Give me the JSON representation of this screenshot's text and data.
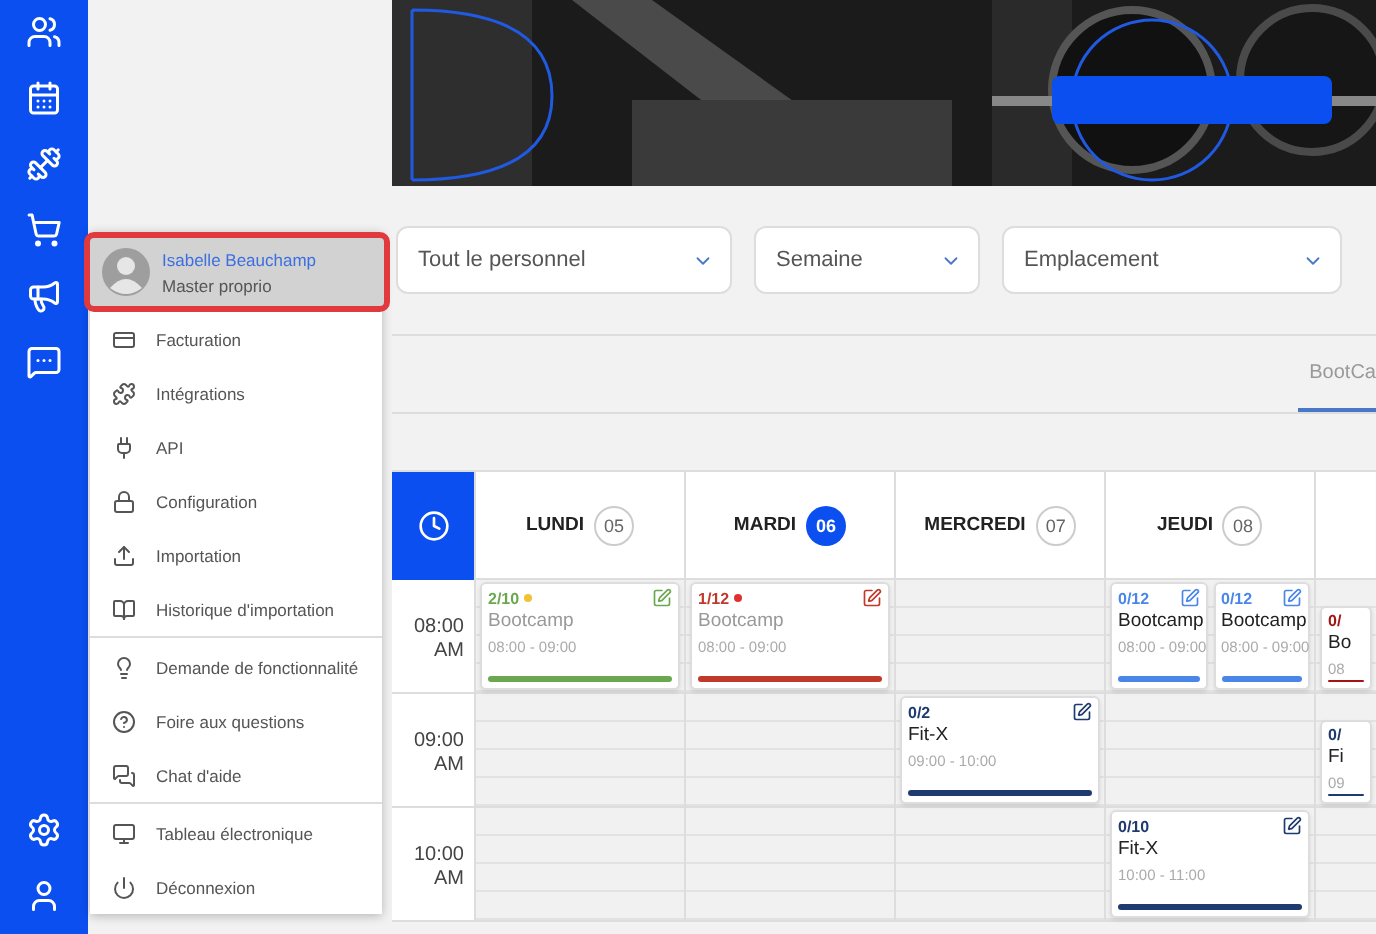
{
  "filters": [
    {
      "label": "Tout le personnel"
    },
    {
      "label": "Semaine"
    },
    {
      "label": "Emplacement"
    }
  ],
  "tabs": [
    {
      "label": "BootCa",
      "selected": true
    }
  ],
  "calendar": {
    "days": [
      {
        "name": "LUNDI",
        "date": "05",
        "selected": false
      },
      {
        "name": "MARDI",
        "date": "06",
        "selected": true
      },
      {
        "name": "MERCREDI",
        "date": "07",
        "selected": false
      },
      {
        "name": "JEUDI",
        "date": "08",
        "selected": false
      }
    ],
    "hours": [
      {
        "time": "08:00",
        "period": "AM",
        "cells": [
          [
            {
              "count": "2/10",
              "color": "#6aa84f",
              "dot": {
                "color": "#f1c232"
              },
              "title": "Bootcamp",
              "time": "08:00 - 09:00",
              "past": true,
              "edit": true
            }
          ],
          [
            {
              "count": "1/12",
              "color": "#c0392b",
              "dot": {
                "color": "#e03030"
              },
              "title": "Bootcamp",
              "time": "08:00 - 09:00",
              "past": true,
              "edit": true
            }
          ],
          [],
          [
            {
              "count": "0/12",
              "color": "#4a86e8",
              "title": "Bootcamp",
              "time": "08:00 - 09:00",
              "past": false,
              "edit": true
            },
            {
              "count": "0/12",
              "color": "#4a86e8",
              "title": "Bootcamp",
              "time": "08:00 - 09:00",
              "past": false,
              "edit": true
            }
          ],
          [
            {
              "count": "0/",
              "color": "#a31515",
              "title": "Bo",
              "time": "08",
              "past": false,
              "edit": false,
              "shifted": true
            }
          ]
        ]
      },
      {
        "time": "09:00",
        "period": "AM",
        "cells": [
          [],
          [],
          [
            {
              "count": "0/2",
              "color": "#1f3a6e",
              "title": "Fit-X",
              "time": "09:00 - 10:00",
              "past": false,
              "edit": true
            }
          ],
          [],
          [
            {
              "count": "0/",
              "color": "#1f3a6e",
              "title": "Fi",
              "time": "09",
              "past": false,
              "edit": false,
              "shifted": true
            }
          ]
        ]
      },
      {
        "time": "10:00",
        "period": "AM",
        "cells": [
          [],
          [],
          [],
          [
            {
              "count": "0/10",
              "color": "#1f3a6e",
              "title": "Fit-X",
              "time": "10:00 - 11:00",
              "past": false,
              "edit": true
            }
          ],
          []
        ]
      }
    ]
  },
  "user_menu": {
    "name": "Isabelle Beauchamp",
    "role": "Master proprio",
    "highlighted": true,
    "groups": [
      [
        {
          "label": "Facturation"
        },
        {
          "label": "Intégrations"
        },
        {
          "label": "API"
        },
        {
          "label": "Configuration"
        },
        {
          "label": "Importation"
        },
        {
          "label": "Historique d'importation"
        }
      ],
      [
        {
          "label": "Demande de fonctionnalité"
        },
        {
          "label": "Foire aux questions"
        },
        {
          "label": "Chat d'aide"
        }
      ],
      [
        {
          "label": "Tableau électronique"
        },
        {
          "label": "Déconnexion"
        }
      ]
    ]
  }
}
